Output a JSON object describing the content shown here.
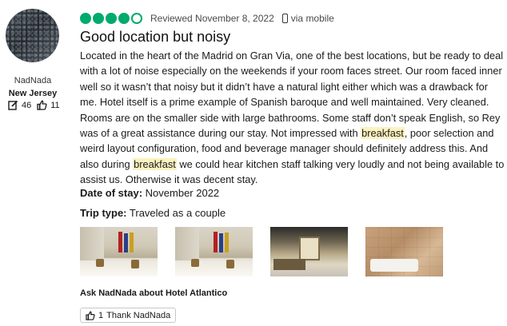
{
  "reviewer": {
    "name": "NadNada",
    "location": "New Jersey",
    "contributions": "46",
    "helpful_votes": "11"
  },
  "review": {
    "rating": 4,
    "rating_max": 5,
    "reviewed_date": "Reviewed November 8, 2022",
    "device": "via mobile",
    "title": "Good location but noisy",
    "body_segments": [
      {
        "text": "Located in the heart of the Madrid on Gran Via, one of the best locations, but be ready to deal with a lot of noise especially on the weekends if your room faces street. Our room faced inner well so it wasn’t that noisy but it didn’t have a natural light either which was a drawback for me. Hotel itself is a prime example of Spanish baroque and well maintained. Very cleaned. Rooms are on the smaller side with large bathrooms. Some staff don’t speak English, so Rey was of a great assistance during our stay. Not impressed with "
      },
      {
        "text": "breakfast",
        "highlight": true
      },
      {
        "text": ", poor selection and weird layout configuration, food and beverage manager should definitely address this. And also during "
      },
      {
        "text": "breakfast",
        "highlight": true
      },
      {
        "text": " we could hear kitchen staff talking very loudly and not being available to assist us. Otherwise it was decent stay."
      }
    ],
    "date_of_stay_label": "Date of stay:",
    "date_of_stay_value": "November 2022",
    "trip_type_label": "Trip type:",
    "trip_type_value": "Traveled as a couple",
    "ask_text": "Ask NadNada about Hotel Atlantico",
    "thank_count": "1",
    "thank_label": "Thank NadNada"
  },
  "colors": {
    "rating_bubble": "#00aa6c",
    "highlight": "#fbf2c0"
  },
  "icons": {
    "contributions": "pencil-square-icon",
    "helpful": "thumbs-up-icon",
    "device": "mobile-phone-icon",
    "thank": "thumbs-up-icon"
  }
}
